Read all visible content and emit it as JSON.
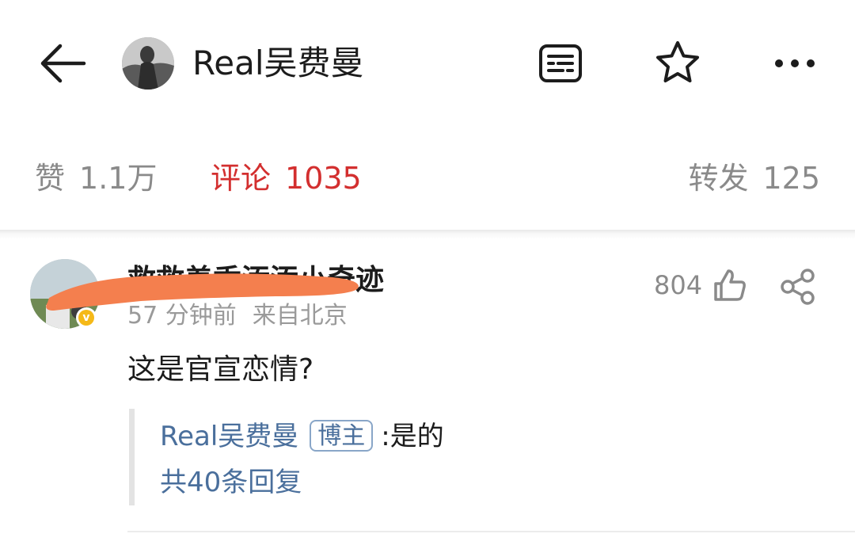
{
  "header": {
    "title": "Real吴费曼",
    "back_icon": "back-arrow-icon",
    "note_icon": "note-icon",
    "star_icon": "star-icon",
    "more_icon": "more-icon"
  },
  "stats": {
    "likes_label": "赞",
    "likes_value": "1.1万",
    "comments_label": "评论",
    "comments_value": "1035",
    "reposts_label": "转发",
    "reposts_value": "125",
    "active_color": "#d32f2f"
  },
  "comment": {
    "username": "救救羞香添添小奇迹",
    "time": "57 分钟前",
    "location": "来自北京",
    "like_count": "804",
    "text": "这是官宣恋情?",
    "reply": {
      "author": "Real吴费曼",
      "badge": "博主",
      "separator": ":",
      "text": "是的"
    },
    "more_replies": "共40条回复"
  }
}
